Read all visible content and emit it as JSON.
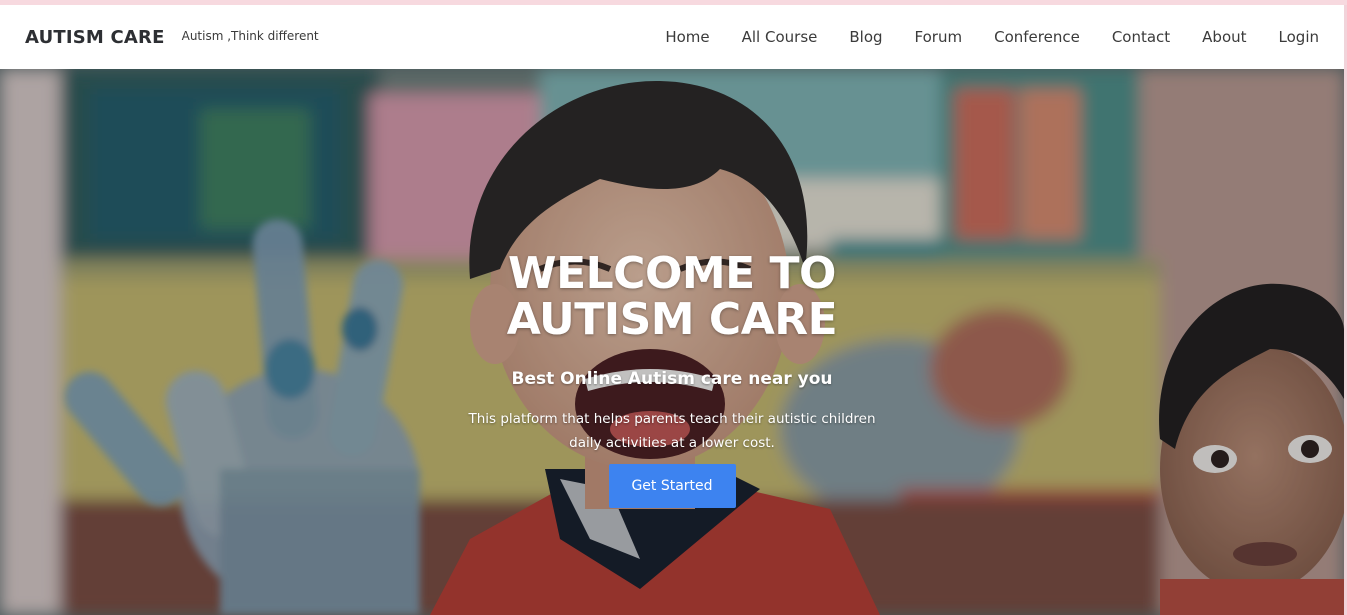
{
  "header": {
    "brand": "AUTISM CARE",
    "tagline": "Autism ,Think different"
  },
  "nav": {
    "items": [
      {
        "label": "Home"
      },
      {
        "label": "All Course"
      },
      {
        "label": "Blog"
      },
      {
        "label": "Forum"
      },
      {
        "label": "Conference"
      },
      {
        "label": "Contact"
      },
      {
        "label": "About"
      },
      {
        "label": "Login"
      }
    ]
  },
  "hero": {
    "title_line1": "WELCOME TO",
    "title_line2": "AUTISM CARE",
    "subtitle": "Best Online Autism care near you",
    "description_line1": "This platform that helps parents teach their autistic children",
    "description_line2": "daily activities at a lower cost.",
    "cta_label": "Get Started",
    "image_subject": "child-laughing-photo"
  },
  "colors": {
    "cta": "#3d83f0",
    "brand_text": "#2d2f33",
    "top_strip": "#f7d9df"
  }
}
